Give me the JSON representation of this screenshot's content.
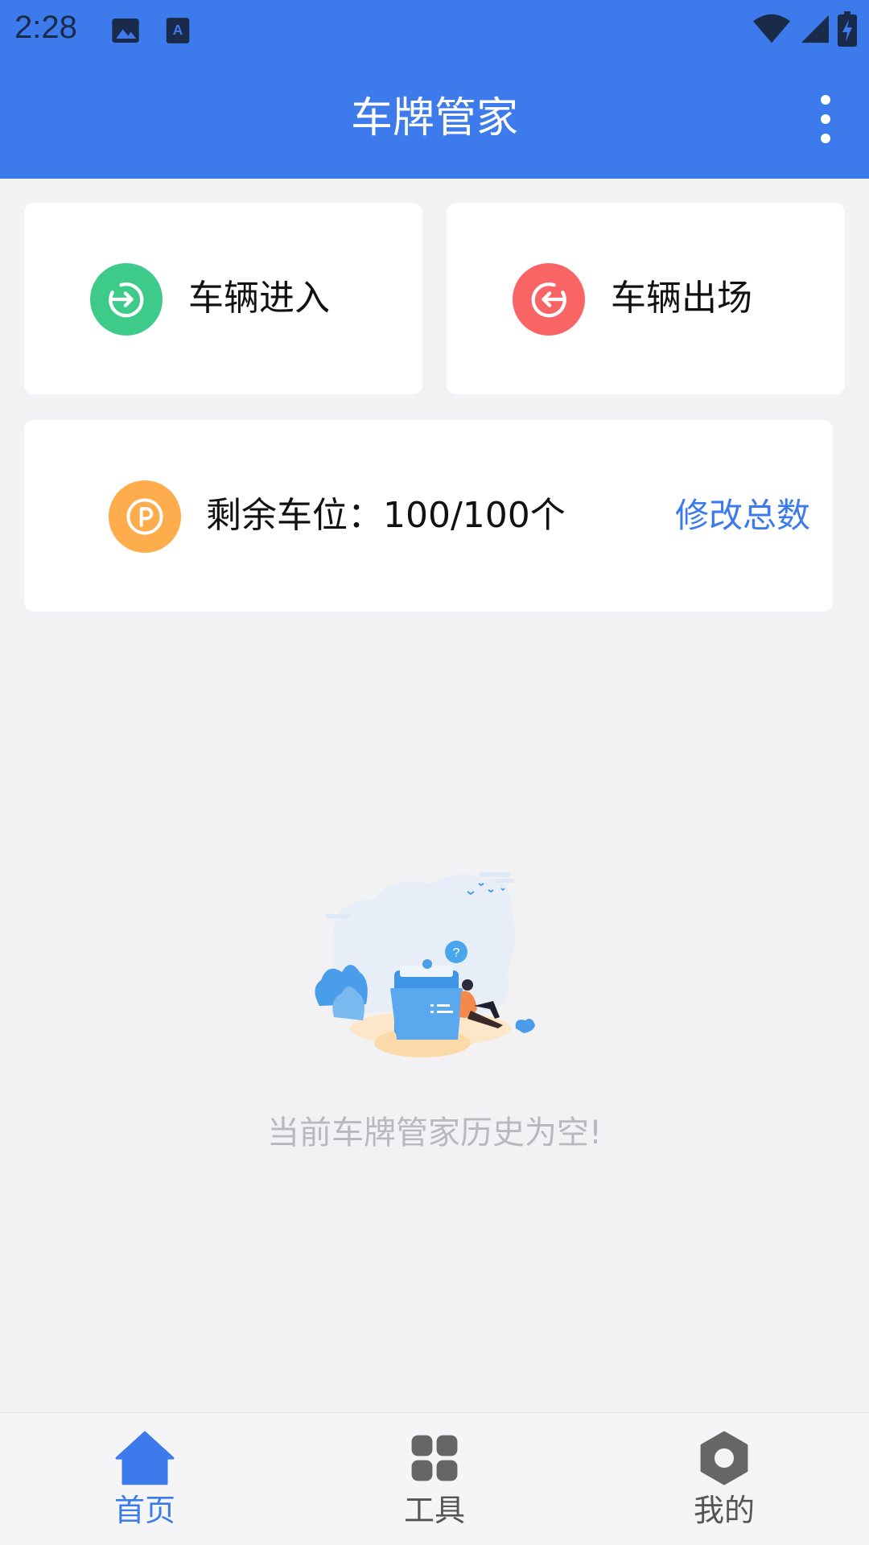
{
  "status_bar": {
    "time": "2:28"
  },
  "app_bar": {
    "title": "车牌管家"
  },
  "actions": {
    "enter_label": "车辆进入",
    "exit_label": "车辆出场"
  },
  "parking": {
    "remaining_label": "剩余车位：100/100个",
    "edit_label": "修改总数"
  },
  "empty_state": {
    "message": "当前车牌管家历史为空!"
  },
  "bottom_nav": {
    "items": [
      {
        "label": "首页",
        "icon": "home-icon",
        "active": true
      },
      {
        "label": "工具",
        "icon": "grid-icon",
        "active": false
      },
      {
        "label": "我的",
        "icon": "hexagon-icon",
        "active": false
      }
    ]
  },
  "colors": {
    "primary": "#3d7bec",
    "enter": "#3ecb8a",
    "exit": "#f96465",
    "parking": "#ffac4d",
    "background": "#f2f2f4"
  }
}
